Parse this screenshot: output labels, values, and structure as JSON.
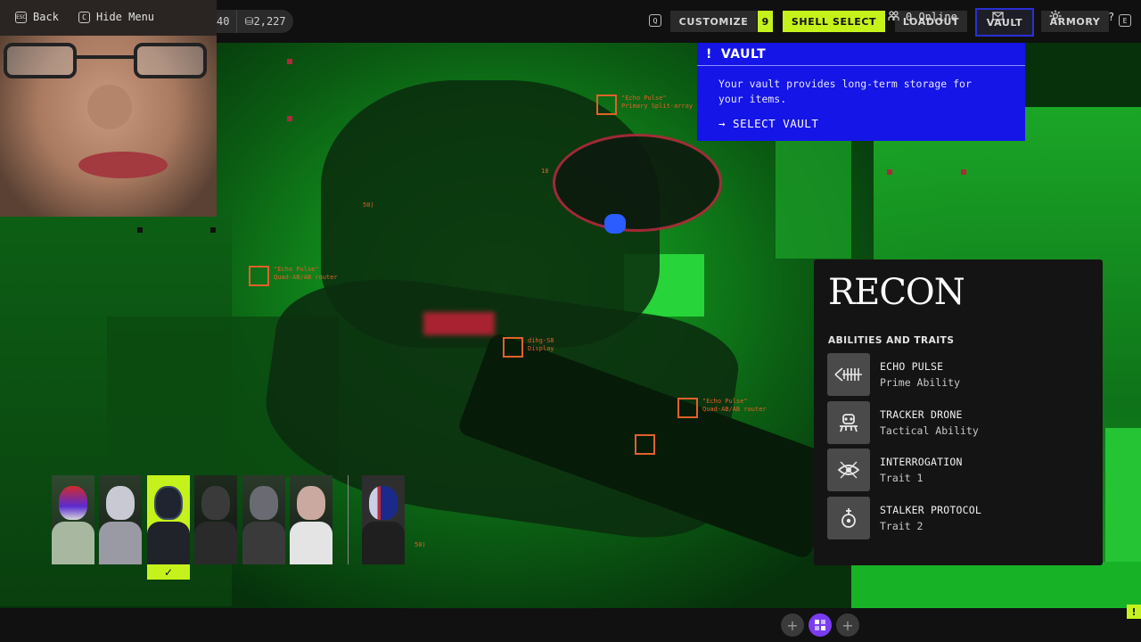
{
  "currency": {
    "left_value": "40",
    "credits": "⛁2,227"
  },
  "nav": {
    "customize": "CUSTOMIZE",
    "customize_badge": "9",
    "shell_select": "SHELL SELECT",
    "loadout": "LOADOUT",
    "vault": "VAULT",
    "armory": "ARMORY",
    "left_key": "Q",
    "right_key": "E"
  },
  "vault_tooltip": {
    "icon": "!",
    "title": "VAULT",
    "description": "Your vault provides long-term storage for your items.",
    "action": "→ SELECT VAULT"
  },
  "hud_labels": [
    "\"Echo Pulse\"\nPrimary Split-array",
    "\"Echo Pulse\"\nQuad-AB/AB router",
    "dihg-S8\nDisplay",
    "\"Echo Pulse\"\nQuad-AB/AB router",
    "18",
    "50)",
    "50)"
  ],
  "recon": {
    "title": "RECON",
    "section_label": "ABILITIES AND TRAITS",
    "abilities": [
      {
        "name": "ECHO PULSE",
        "kind": "Prime Ability",
        "icon": "echo-pulse-icon"
      },
      {
        "name": "TRACKER DRONE",
        "kind": "Tactical Ability",
        "icon": "tracker-drone-icon"
      },
      {
        "name": "INTERROGATION",
        "kind": "Trait 1",
        "icon": "interrogation-icon"
      },
      {
        "name": "STALKER PROTOCOL",
        "kind": "Trait 2",
        "icon": "stalker-protocol-icon"
      }
    ]
  },
  "roster": {
    "selected_index": 2,
    "check_icon": "✓",
    "extra_label": "ESC"
  },
  "bottombar": {
    "back_key": "ESC",
    "back_label": "Back",
    "hide_key": "C",
    "hide_label": "Hide Menu",
    "online_label": "0 Online",
    "alert_flag": "!"
  },
  "colors": {
    "accent": "#c6f21c",
    "vault_blue": "#1515e8",
    "hud_orange": "#e0622a"
  }
}
